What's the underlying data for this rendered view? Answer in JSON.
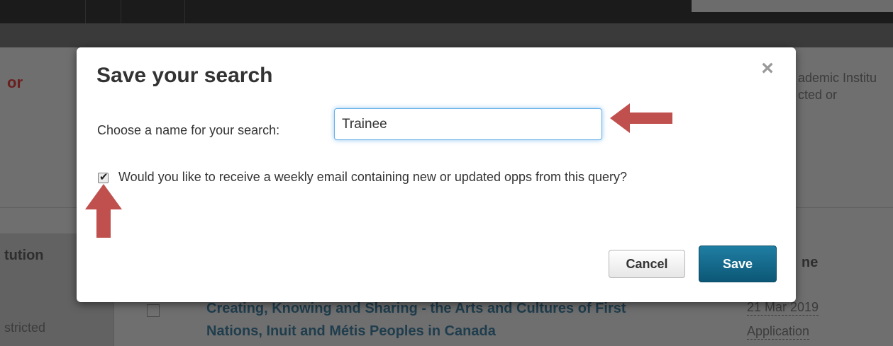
{
  "background": {
    "left_heading_fragment": "or",
    "right_text_line1": "ademic Institu",
    "right_text_line2": "cted or",
    "sidebar_heading_fragment": "tution",
    "sidebar_text_fragment": "stricted",
    "column_heading_fragment": "ne",
    "result_title_line1": "Creating, Knowing and Sharing - the Arts and Cultures of First",
    "result_title_line2": "Nations, Inuit and Métis Peoples in Canada",
    "result_date": "21 Mar 2019",
    "result_type": "Application"
  },
  "modal": {
    "title": "Save your search",
    "close_label": "×",
    "name_label": "Choose a name for your search:",
    "name_value": "Trainee",
    "weekly_email_checked": true,
    "weekly_email_label": "Would you like to receive a weekly email containing new or updated opps from this query?",
    "cancel_label": "Cancel",
    "save_label": "Save"
  },
  "annotations": {
    "arrow_color": "#c0504d",
    "arrows": [
      "left-arrow-icon",
      "up-arrow-icon"
    ]
  }
}
